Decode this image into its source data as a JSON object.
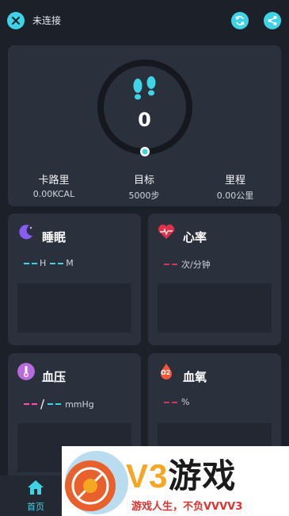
{
  "header": {
    "status": "未连接",
    "close_icon": "close-icon",
    "refresh_icon": "refresh-icon",
    "share_icon": "share-icon"
  },
  "steps": {
    "value": "0",
    "icon": "footprints-icon",
    "stats": [
      {
        "label": "卡路里",
        "value": "0.00KCAL"
      },
      {
        "label": "目标",
        "value": "5000步"
      },
      {
        "label": "里程",
        "value": "0.00公里"
      }
    ]
  },
  "cards": {
    "sleep": {
      "title": "睡眠",
      "h_unit": "H",
      "m_unit": "M",
      "icon": "moon-icon"
    },
    "heart": {
      "title": "心率",
      "unit": "次/分钟",
      "icon": "heart-icon"
    },
    "bp": {
      "title": "血压",
      "sep": "/",
      "unit": "mmHg",
      "icon": "thermometer-icon"
    },
    "spo2": {
      "title": "血氧",
      "unit": "%",
      "icon": "oxygen-icon",
      "badge": "O2"
    }
  },
  "nav": {
    "home_label": "首页",
    "home_icon": "home-icon"
  },
  "ad": {
    "brand": "V3游戏",
    "brand_latin": "V3",
    "brand_cn": "游戏",
    "slogan": "游戏人生，不负VVVV3"
  },
  "colors": {
    "accent": "#3fd3e6",
    "sleep": "#8a5cf5",
    "heart": "#e0314b",
    "bp_pink": "#ff4fb0",
    "bp_cyan": "#3fd3e6",
    "spo2": "#f2563a"
  }
}
